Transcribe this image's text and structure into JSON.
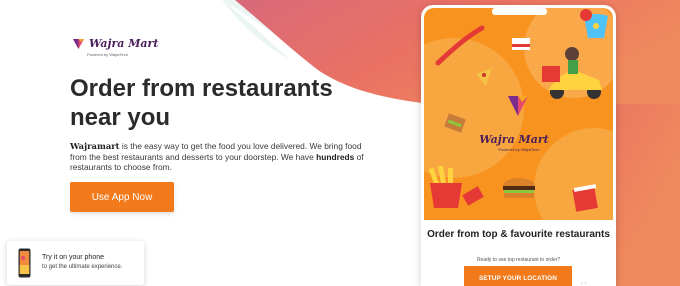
{
  "brand": {
    "name": "Wajra Mart",
    "tagline": "Powered by WajraTech",
    "logo_icon": "diamond-logo-icon"
  },
  "hero": {
    "headline": "Order from restaurants near you",
    "desc_brand": "Wajramart",
    "desc_part1": " is the easy way to get the food you love delivered. We bring food from the best restaurants and desserts to your doorstep. We have ",
    "desc_bold": "hundreds",
    "desc_part2": " of restaurants to choose from.",
    "cta_label": "Use App Now"
  },
  "try_card": {
    "title": "Try it on your phone",
    "subtitle": "to get the ultimate experience.",
    "icon": "phone-icon"
  },
  "phone_app": {
    "screen_brand": "Wajra Mart",
    "screen_tagline": "Powered by WajraTech",
    "title": "Order from top & favourite restaurants",
    "subtitle": "Ready to see top restaurant to order?",
    "button_label": "SETUP YOUR LOCATION"
  },
  "colors": {
    "accent": "#f27a1a",
    "background_blob": "#e8706a",
    "screen_bg": "#f7931e"
  }
}
